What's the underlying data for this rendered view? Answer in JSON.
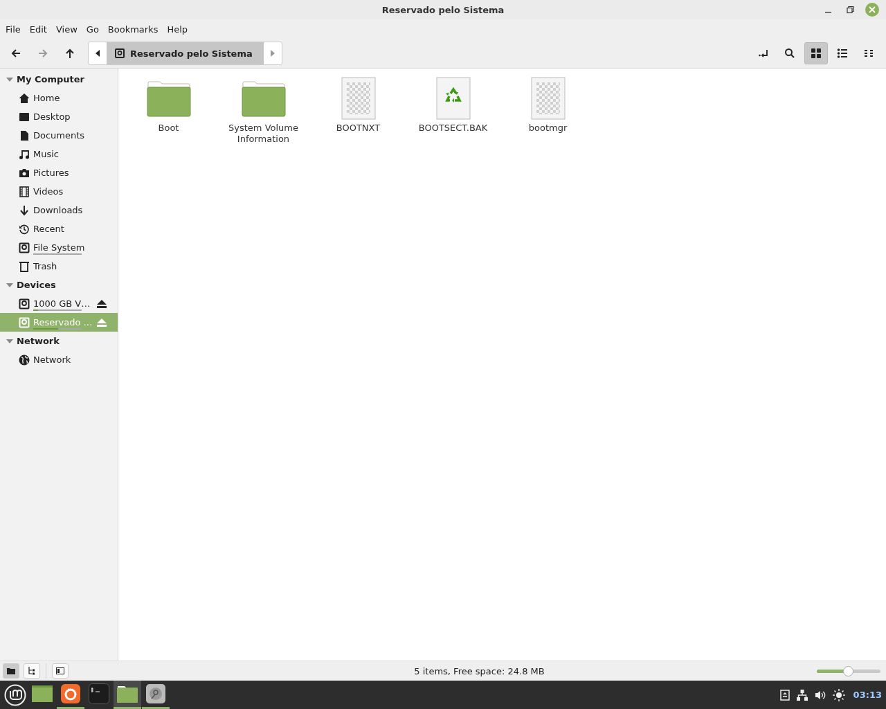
{
  "window": {
    "title": "Reservado pelo Sistema"
  },
  "menu": [
    "File",
    "Edit",
    "View",
    "Go",
    "Bookmarks",
    "Help"
  ],
  "toolbar": {
    "back_disabled": false,
    "forward_disabled": true,
    "location": "Reservado pelo Sistema",
    "views": [
      {
        "selected": false
      },
      {
        "selected": false
      },
      {
        "selected": true
      },
      {
        "selected": false
      },
      {
        "selected": false
      }
    ]
  },
  "sidebar": [
    {
      "label": "My Computer",
      "expanded": true,
      "items": [
        {
          "label": "Home",
          "selected": false,
          "eject": false
        },
        {
          "label": "Desktop",
          "selected": false,
          "eject": false
        },
        {
          "label": "Documents",
          "selected": false,
          "eject": false
        },
        {
          "label": "Music",
          "selected": false,
          "eject": false
        },
        {
          "label": "Pictures",
          "selected": false,
          "eject": false
        },
        {
          "label": "Videos",
          "selected": false,
          "eject": false
        },
        {
          "label": "Downloads",
          "selected": false,
          "eject": false
        },
        {
          "label": "Recent",
          "selected": false,
          "eject": false
        },
        {
          "label": "File System",
          "selected": false,
          "eject": false,
          "usage_bar": true
        },
        {
          "label": "Trash",
          "selected": false,
          "eject": false
        }
      ]
    },
    {
      "label": "Devices",
      "expanded": true,
      "items": [
        {
          "label": "1000 GB V…",
          "selected": false,
          "eject": true,
          "level": 0.1
        },
        {
          "label": "Reservado …",
          "selected": true,
          "eject": true,
          "level": 0.52
        }
      ]
    },
    {
      "label": "Network",
      "expanded": true,
      "items": [
        {
          "label": "Network",
          "selected": false,
          "eject": false
        }
      ]
    }
  ],
  "files": [
    {
      "name": "Boot",
      "kind": "folder"
    },
    {
      "name": "System Volume Information",
      "kind": "folder"
    },
    {
      "name": "BOOTNXT",
      "kind": "file"
    },
    {
      "name": "BOOTSECT.BAK",
      "kind": "recycle"
    },
    {
      "name": "bootmgr",
      "kind": "file"
    }
  ],
  "statusbar": {
    "panes": [
      {
        "selected": true
      },
      {
        "selected": false
      }
    ],
    "text": "5 items, Free space: 24.8 MB",
    "zoom": {
      "level": 0.49
    }
  },
  "taskbar": {
    "apps": [
      {
        "kind": "desktop",
        "running": false,
        "active": false
      },
      {
        "kind": "browser",
        "running": true,
        "active": false
      },
      {
        "kind": "terminal",
        "running": false,
        "active": false
      },
      {
        "kind": "files",
        "running": true,
        "active": true
      },
      {
        "kind": "disks",
        "running": true,
        "active": false
      }
    ],
    "time": "03:13"
  }
}
